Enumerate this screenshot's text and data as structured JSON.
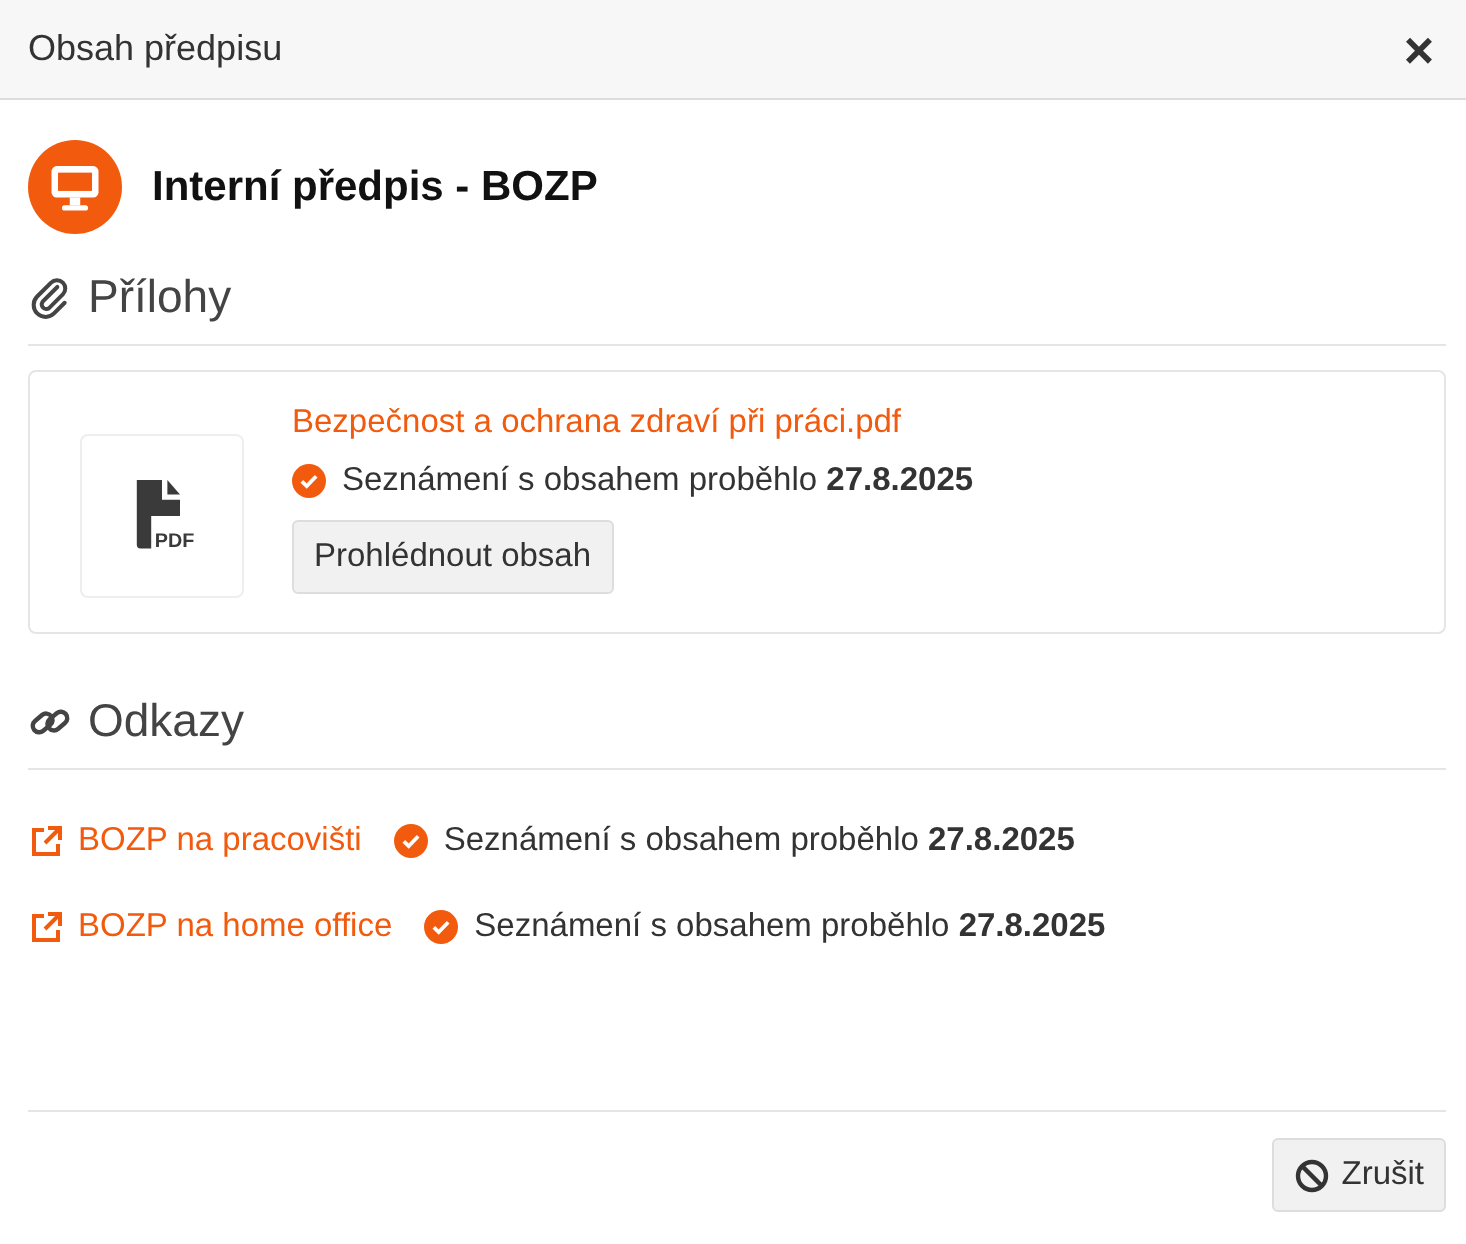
{
  "window": {
    "title": "Obsah předpisu",
    "close": "×"
  },
  "document": {
    "title": "Interní předpis - BOZP"
  },
  "attachments": {
    "heading": "Přílohy",
    "items": [
      {
        "file_label": "PDF",
        "name": "Bezpečnost a ochrana zdraví při práci.pdf",
        "acknowledged": true,
        "status": "Seznámení s obsahem proběhlo **27.8.2025**",
        "button": "Prohlédnout obsah"
      }
    ]
  },
  "links": {
    "heading": "Odkazy",
    "items": [
      {
        "name": "BOZP na pracovišti",
        "acknowledged": true,
        "status": "Seznámení s obsahem proběhlo **27.8.2025**"
      },
      {
        "name": "BOZP na home office",
        "acknowledged": true,
        "status": "Seznámení s obsahem proběhlo **27.8.2025**"
      }
    ]
  },
  "footer": {
    "cancel": "Zrušit"
  }
}
